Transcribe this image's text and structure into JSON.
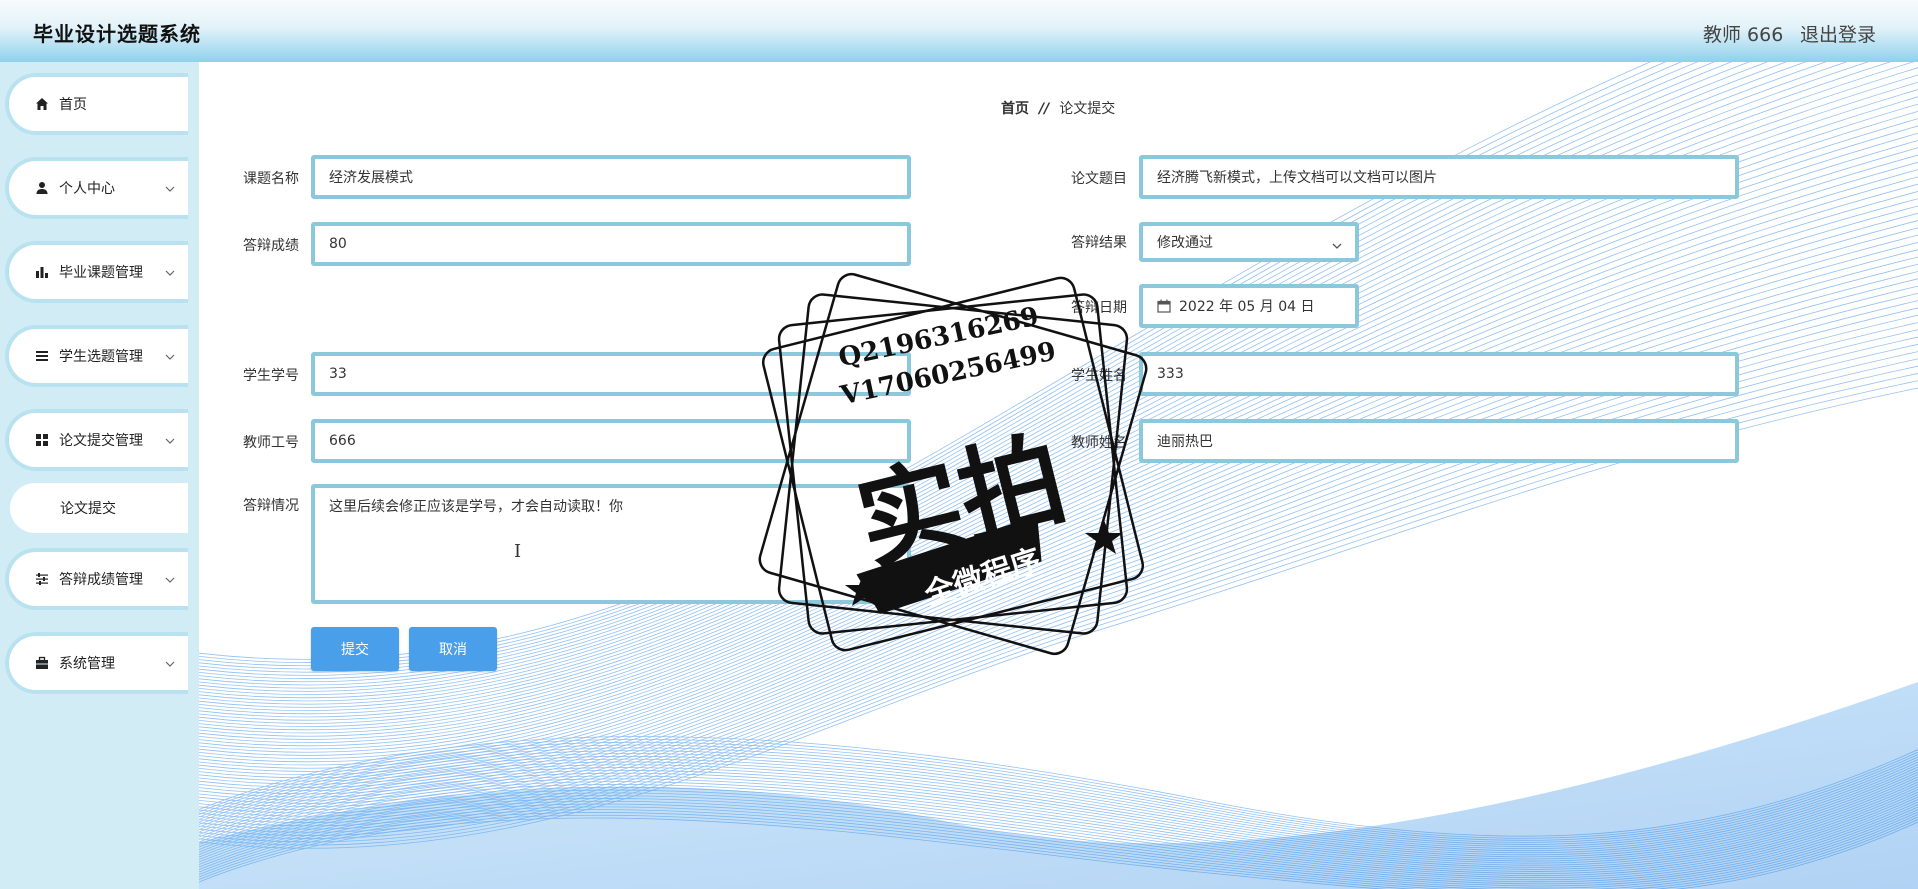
{
  "header": {
    "app_title": "毕业设计选题系统",
    "user_label": "教师 666",
    "logout_label": "退出登录"
  },
  "sidebar": {
    "items": [
      {
        "label": "首页",
        "icon": "home-icon"
      },
      {
        "label": "个人中心",
        "icon": "user-icon"
      },
      {
        "label": "毕业课题管理",
        "icon": "bar-chart-icon"
      },
      {
        "label": "学生选题管理",
        "icon": "list-icon"
      },
      {
        "label": "论文提交管理",
        "icon": "grid-icon"
      },
      {
        "label": "答辩成绩管理",
        "icon": "sliders-icon"
      },
      {
        "label": "系统管理",
        "icon": "briefcase-icon"
      }
    ],
    "active_sub": "论文提交"
  },
  "breadcrumb": {
    "home": "首页",
    "separator": "//",
    "current": "论文提交"
  },
  "form": {
    "topic_name": {
      "label": "课题名称",
      "value": "经济发展模式"
    },
    "paper_title": {
      "label": "论文题目",
      "value": "经济腾飞新模式，上传文档可以文档可以图片"
    },
    "defense_score": {
      "label": "答辩成绩",
      "value": "80"
    },
    "defense_result": {
      "label": "答辩结果",
      "value": "修改通过"
    },
    "defense_date": {
      "label": "答辩日期",
      "value": "2022 年 05 月 04 日"
    },
    "student_id": {
      "label": "学生学号",
      "value": "33"
    },
    "student_name": {
      "label": "学生姓名",
      "value": "333"
    },
    "teacher_id": {
      "label": "教师工号",
      "value": "666"
    },
    "teacher_name": {
      "label": "教师姓名",
      "value": "迪丽热巴"
    },
    "defense_notes": {
      "label": "答辩情况",
      "value": "这里后续会修正应该是学号，才会自动读取！你"
    },
    "submit_label": "提交",
    "cancel_label": "取消"
  },
  "watermark": {
    "line1": "Q2196316269",
    "line2": "V17060256499",
    "big": "实拍",
    "banner": "全微程序"
  },
  "colors": {
    "accent": "#4a9fea",
    "field_border": "#8cc8db",
    "sidebar_bg": "#d2ecf5",
    "wave_blue": "#3a8ee8"
  }
}
